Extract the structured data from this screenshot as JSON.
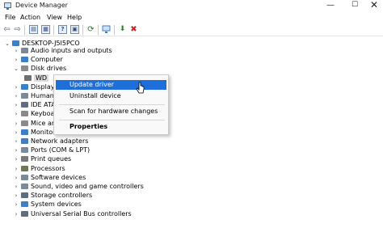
{
  "window": {
    "title": "Device Manager",
    "min": "—",
    "max": "☐",
    "close": "✕"
  },
  "menu": [
    "File",
    "Action",
    "View",
    "Help"
  ],
  "toolbar": [
    {
      "icon": "back-arrow-icon",
      "glyph": "⇦"
    },
    {
      "icon": "forward-arrow-icon",
      "glyph": "⇨"
    },
    {
      "icon": "show-hide-tree-icon",
      "glyph": "▤"
    },
    {
      "icon": "properties-icon",
      "glyph": "▦"
    },
    {
      "icon": "help-icon",
      "glyph": "?"
    },
    {
      "icon": "resources-icon",
      "glyph": "▣"
    },
    {
      "icon": "update-driver-icon",
      "glyph": "⟳"
    },
    {
      "icon": "scan-hardware-icon",
      "glyph": "🖵"
    },
    {
      "icon": "enable-device-icon",
      "glyph": "⬇"
    },
    {
      "icon": "uninstall-icon",
      "glyph": "✖"
    }
  ],
  "tree": {
    "root": "DESKTOP-J5I5PCO",
    "items": [
      {
        "label": "Audio inputs and outputs",
        "icon": "speaker-icon",
        "color": "#7a8a99",
        "expanded": false
      },
      {
        "label": "Computer",
        "icon": "computer-icon",
        "color": "#3f7fc6",
        "expanded": false
      },
      {
        "label": "Disk drives",
        "icon": "disk-icon",
        "color": "#8c8c8c",
        "expanded": true
      },
      {
        "label": "WD",
        "icon": "hard-drive-icon",
        "color": "#6f6f6f",
        "child": true,
        "selected": true
      },
      {
        "label": "Display",
        "icon": "display-adapter-icon",
        "color": "#3f7fc6",
        "expanded": false
      },
      {
        "label": "Human",
        "icon": "hid-icon",
        "color": "#7a8a99",
        "expanded": false
      },
      {
        "label": "IDE ATA",
        "icon": "ide-controller-icon",
        "color": "#5e6e80",
        "expanded": false
      },
      {
        "label": "Keyboa",
        "icon": "keyboard-icon",
        "color": "#8a8a8a",
        "expanded": false
      },
      {
        "label": "Mice ar",
        "icon": "mouse-icon",
        "color": "#8a8a8a",
        "expanded": false
      },
      {
        "label": "Monitors",
        "icon": "monitor-icon",
        "color": "#3f7fc6",
        "expanded": false
      },
      {
        "label": "Network adapters",
        "icon": "network-icon",
        "color": "#3f7fc6",
        "expanded": false
      },
      {
        "label": "Ports (COM & LPT)",
        "icon": "port-icon",
        "color": "#7a8a99",
        "expanded": false
      },
      {
        "label": "Print queues",
        "icon": "printer-icon",
        "color": "#7a7a7a",
        "expanded": false
      },
      {
        "label": "Processors",
        "icon": "processor-icon",
        "color": "#6a7a55",
        "expanded": false
      },
      {
        "label": "Software devices",
        "icon": "software-device-icon",
        "color": "#7a8a99",
        "expanded": false
      },
      {
        "label": "Sound, video and game controllers",
        "icon": "sound-icon",
        "color": "#7a8a99",
        "expanded": false
      },
      {
        "label": "Storage controllers",
        "icon": "storage-controller-icon",
        "color": "#5e6e80",
        "expanded": false
      },
      {
        "label": "System devices",
        "icon": "system-device-icon",
        "color": "#3f7fc6",
        "expanded": false
      },
      {
        "label": "Universal Serial Bus controllers",
        "icon": "usb-icon",
        "color": "#5e6e80",
        "expanded": false
      }
    ]
  },
  "context_menu": {
    "update": "Update driver",
    "uninstall": "Uninstall device",
    "scan": "Scan for hardware changes",
    "properties": "Properties"
  }
}
